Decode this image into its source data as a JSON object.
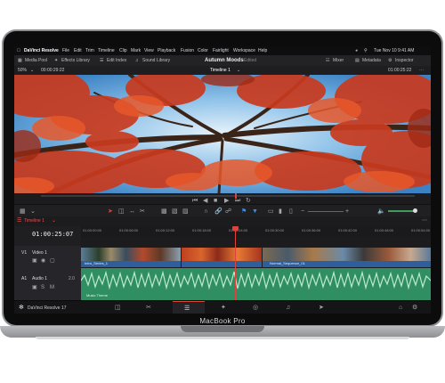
{
  "device": {
    "label": "MacBook Pro"
  },
  "menubar": {
    "app_name": "DaVinci Resolve",
    "items": [
      "File",
      "Edit",
      "Trim",
      "Timeline",
      "Clip",
      "Mark",
      "View",
      "Playback",
      "Fusion",
      "Color",
      "Fairlight",
      "Workspace",
      "Help"
    ],
    "clock": "Tue Nov 10  9:41 AM"
  },
  "toolbar": {
    "left": [
      "Media Pool",
      "Effects Library",
      "Edit Index",
      "Sound Library"
    ],
    "project_title": "Autumn Moods",
    "project_state": "Edited",
    "right": [
      "Mixer",
      "Metadata",
      "Inspector"
    ]
  },
  "viewer": {
    "zoom": "50%",
    "timecode_left": "00:00:29:22",
    "timeline_name": "Timeline 1",
    "timecode_right": "01:00:25:22"
  },
  "timeline": {
    "tab": "Timeline 1",
    "timecode": "01:00:25:07",
    "ruler_ticks": [
      "01:00:00:00",
      "01:00:06:00",
      "01:00:12:00",
      "01:00:18:00",
      "01:00:24:00",
      "01:00:30:00",
      "01:00:36:00",
      "01:00:42:00",
      "01:00:48:00",
      "01:00:54:00"
    ],
    "video_track": {
      "id": "V1",
      "name": "Video 1",
      "clips": [
        "Intro_Series_1",
        "Normal_Sequence_01"
      ]
    },
    "audio_track": {
      "id": "A1",
      "name": "Audio 1",
      "level": "2.0",
      "clip": "Music Theme"
    }
  },
  "footer": {
    "app_version": "DaVinci Resolve 17"
  },
  "colors": {
    "accent_red": "#e0423b",
    "audio_green": "#2f8f62",
    "video_blue": "#3a6fb0"
  }
}
